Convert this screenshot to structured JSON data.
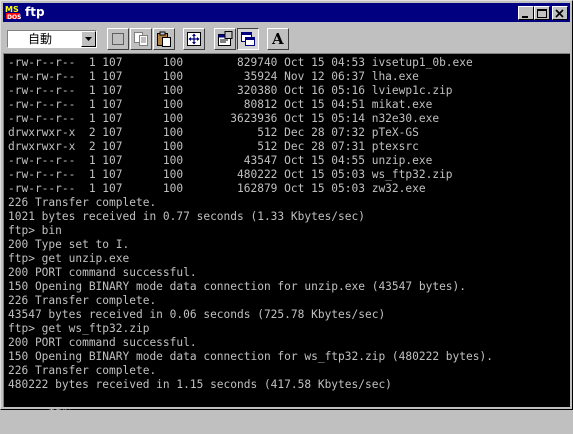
{
  "window": {
    "title": "ftp",
    "app_icon": "ms-dos-icon"
  },
  "toolbar": {
    "font_select_value": "自動",
    "font_button_glyph": "A",
    "buttons": [
      "mark-icon",
      "copy-icon",
      "paste-icon",
      "fullscreen-icon",
      "properties-icon",
      "background-icon",
      "font-icon"
    ]
  },
  "console": {
    "prompt_line": "ftp>",
    "lines": [
      "-rw-r--r--  1 107      100        829740 Oct 15 04:53 ivsetup1_0b.exe",
      "-rw-rw-r--  1 107      100         35924 Nov 12 06:37 lha.exe",
      "-rw-r--r--  1 107      100        320380 Oct 16 05:16 lviewp1c.zip",
      "-rw-r--r--  1 107      100         80812 Oct 15 04:51 mikat.exe",
      "-rw-r--r--  1 107      100       3623936 Oct 15 05:14 n32e30.exe",
      "drwxrwxr-x  2 107      100           512 Dec 28 07:32 pTeX-GS",
      "drwxrwxr-x  2 107      100           512 Dec 28 07:31 ptexsrc",
      "-rw-r--r--  1 107      100         43547 Oct 15 04:55 unzip.exe",
      "-rw-r--r--  1 107      100        480222 Oct 15 05:03 ws_ftp32.zip",
      "-rw-r--r--  1 107      100        162879 Oct 15 05:03 zw32.exe",
      "226 Transfer complete.",
      "1021 bytes received in 0.77 seconds (1.33 Kbytes/sec)",
      "ftp> bin",
      "200 Type set to I.",
      "ftp> get unzip.exe",
      "200 PORT command successful.",
      "150 Opening BINARY mode data connection for unzip.exe (43547 bytes).",
      "226 Transfer complete.",
      "43547 bytes received in 0.06 seconds (725.78 Kbytes/sec)",
      "ftp> get ws_ftp32.zip",
      "200 PORT command successful.",
      "150 Opening BINARY mode data connection for ws_ftp32.zip (480222 bytes).",
      "226 Transfer complete.",
      "480222 bytes received in 1.15 seconds (417.58 Kbytes/sec)"
    ]
  },
  "colors": {
    "titlebar": "#000080",
    "console_bg": "#000000",
    "console_text": "#c0c0c0",
    "chrome": "#c0c0c0"
  }
}
